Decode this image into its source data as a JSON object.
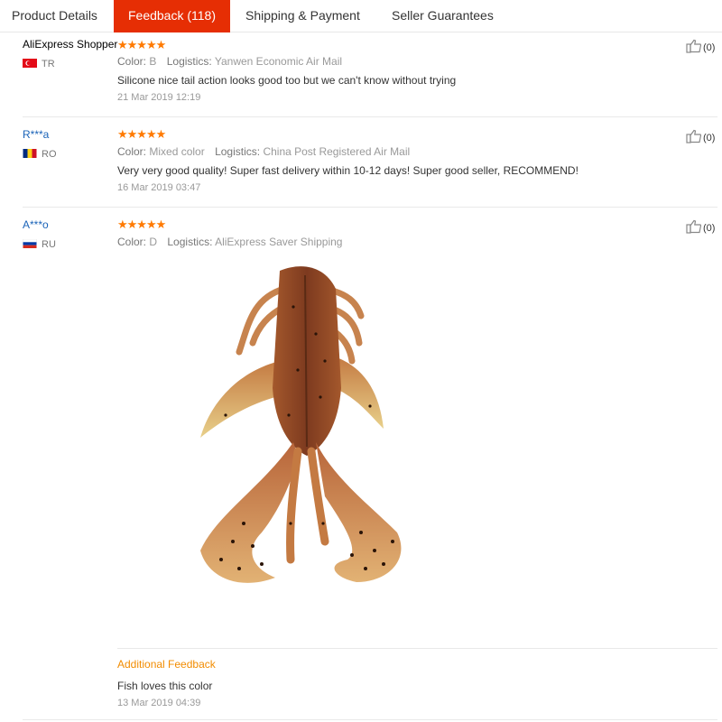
{
  "tabs": [
    {
      "label": "Product Details"
    },
    {
      "label": "Feedback (118)"
    },
    {
      "label": "Shipping & Payment"
    },
    {
      "label": "Seller Guarantees"
    }
  ],
  "active_tab": 1,
  "reviews": [
    {
      "user": "AliExpress Shopper",
      "country": "TR",
      "stars": "★★★★★",
      "color_label": "Color:",
      "color": "B",
      "logistics_label": "Logistics:",
      "logistics": "Yanwen Economic Air Mail",
      "text": "Silicone nice tail action looks good too but we can't know without trying",
      "date": "21 Mar 2019 12:19",
      "likes": "(0)"
    },
    {
      "user": "R***a",
      "country": "RO",
      "stars": "★★★★★",
      "color_label": "Color:",
      "color": "Mixed color",
      "logistics_label": "Logistics:",
      "logistics": "China Post Registered Air Mail",
      "text": "Very very good quality! Super fast delivery within 10-12 days! Super good seller, RECOMMEND!",
      "date": "16 Mar 2019 03:47",
      "likes": "(0)"
    },
    {
      "user": "A***o",
      "country": "RU",
      "stars": "★★★★★",
      "color_label": "Color:",
      "color": "D",
      "logistics_label": "Logistics:",
      "logistics": "AliExpress Saver Shipping",
      "likes": "(0)",
      "additional_feedback": {
        "title": "Additional Feedback",
        "text": "Fish loves this color",
        "date": "13 Mar 2019 04:39"
      }
    }
  ],
  "colors": {
    "active_tab": "#e62e04",
    "stars": "#ff7a00",
    "masked_user": "#1a63b8",
    "additional_feedback": "#f28c00"
  },
  "icons": [
    "thumbs-up-icon",
    "flag-icon"
  ]
}
